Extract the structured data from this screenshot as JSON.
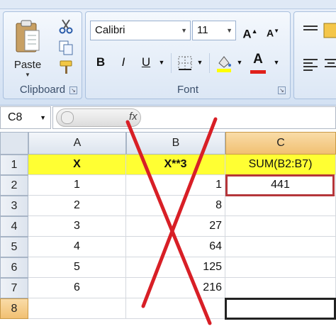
{
  "ribbon": {
    "clipboard": {
      "label": "Clipboard",
      "paste_label": "Paste"
    },
    "font": {
      "label": "Font",
      "font_name": "Calibri",
      "font_size": "11",
      "bold": "B",
      "italic": "I",
      "underline": "U",
      "grow": "A",
      "shrink": "A",
      "font_color_glyph": "A",
      "font_color": "#e0201b",
      "fill_color": "#ffff00"
    }
  },
  "formula_bar": {
    "name_box": "C8",
    "fx": "fx"
  },
  "grid": {
    "columns": [
      "A",
      "B",
      "C"
    ],
    "rows": [
      {
        "num": "1",
        "a": "X",
        "b": "X**3",
        "c": "SUM(B2:B7)"
      },
      {
        "num": "2",
        "a": "1",
        "b": "1",
        "c": "441"
      },
      {
        "num": "3",
        "a": "2",
        "b": "8",
        "c": ""
      },
      {
        "num": "4",
        "a": "3",
        "b": "27",
        "c": ""
      },
      {
        "num": "5",
        "a": "4",
        "b": "64",
        "c": ""
      },
      {
        "num": "6",
        "a": "5",
        "b": "125",
        "c": ""
      },
      {
        "num": "7",
        "a": "6",
        "b": "216",
        "c": ""
      },
      {
        "num": "8",
        "a": "",
        "b": "",
        "c": ""
      }
    ],
    "header_fill": "#ffff33"
  },
  "annotation": {
    "cross_color": "#d81f26"
  }
}
